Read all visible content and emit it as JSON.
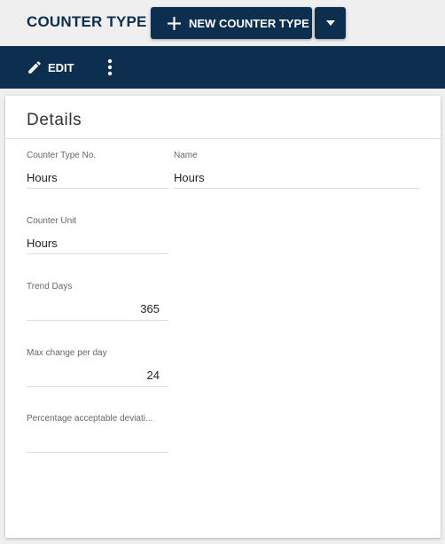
{
  "header": {
    "title": "COUNTER TYPE",
    "new_button_label": "NEW COUNTER TYPE"
  },
  "toolbar": {
    "edit_label": "EDIT"
  },
  "details": {
    "title": "Details",
    "fields": {
      "counter_type_no": {
        "label": "Counter Type No.",
        "value": "Hours"
      },
      "name": {
        "label": "Name",
        "value": "Hours"
      },
      "counter_unit": {
        "label": "Counter Unit",
        "value": "Hours"
      },
      "trend_days": {
        "label": "Trend Days",
        "value": "365"
      },
      "max_change_per_day": {
        "label": "Max change per day",
        "value": "24"
      },
      "percentage_acceptable_deviation": {
        "label": "Percentage acceptable deviati...",
        "value": ""
      }
    }
  },
  "colors": {
    "primary": "#0d2f4f",
    "background": "#efefef",
    "card": "#ffffff"
  }
}
